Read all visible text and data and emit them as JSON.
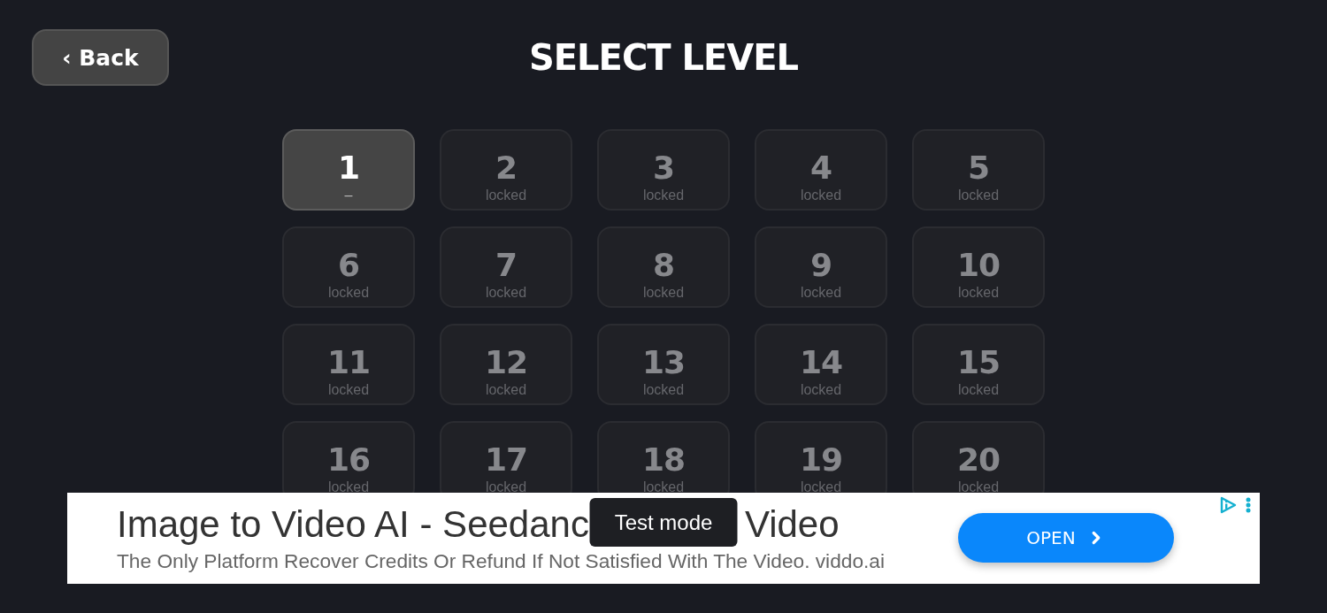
{
  "header": {
    "back_button": "‹ Back",
    "title": "SELECT LEVEL"
  },
  "levels": [
    {
      "number": "1",
      "sublabel": "–",
      "locked": false
    },
    {
      "number": "2",
      "sublabel": "locked",
      "locked": true
    },
    {
      "number": "3",
      "sublabel": "locked",
      "locked": true
    },
    {
      "number": "4",
      "sublabel": "locked",
      "locked": true
    },
    {
      "number": "5",
      "sublabel": "locked",
      "locked": true
    },
    {
      "number": "6",
      "sublabel": "locked",
      "locked": true
    },
    {
      "number": "7",
      "sublabel": "locked",
      "locked": true
    },
    {
      "number": "8",
      "sublabel": "locked",
      "locked": true
    },
    {
      "number": "9",
      "sublabel": "locked",
      "locked": true
    },
    {
      "number": "10",
      "sublabel": "locked",
      "locked": true
    },
    {
      "number": "11",
      "sublabel": "locked",
      "locked": true
    },
    {
      "number": "12",
      "sublabel": "locked",
      "locked": true
    },
    {
      "number": "13",
      "sublabel": "locked",
      "locked": true
    },
    {
      "number": "14",
      "sublabel": "locked",
      "locked": true
    },
    {
      "number": "15",
      "sublabel": "locked",
      "locked": true
    },
    {
      "number": "16",
      "sublabel": "locked",
      "locked": true
    },
    {
      "number": "17",
      "sublabel": "locked",
      "locked": true
    },
    {
      "number": "18",
      "sublabel": "locked",
      "locked": true
    },
    {
      "number": "19",
      "sublabel": "locked",
      "locked": true
    },
    {
      "number": "20",
      "sublabel": "locked",
      "locked": true
    }
  ],
  "ad": {
    "headline_parts": [
      "Image to Video AI - Seedanc",
      "Video"
    ],
    "description": "The Only Platform Recover Credits Or Refund If Not Satisfied With The Video. viddo.ai",
    "button": "OPEN"
  },
  "toast": "Test mode"
}
